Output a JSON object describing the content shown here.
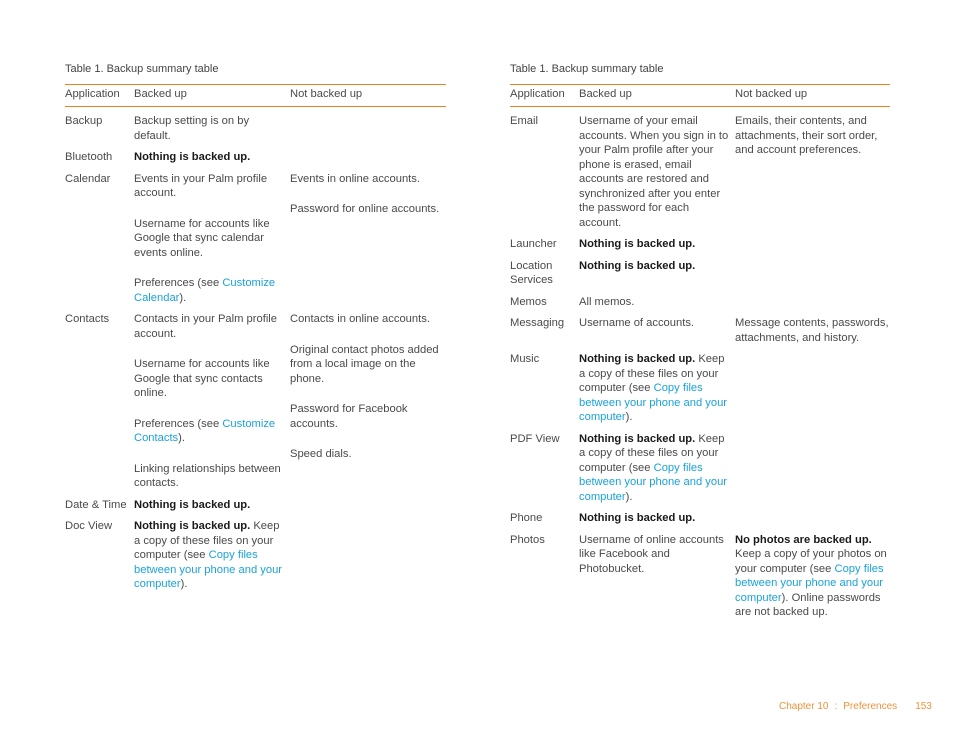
{
  "colors": {
    "rule": "#e8821e",
    "link": "#1aa3d9",
    "footer": "#f0923a"
  },
  "tables": [
    {
      "caption": "Table 1.  Backup summary table",
      "headers": {
        "app": "Application",
        "yes": "Backed up",
        "no": "Not backed up"
      },
      "rows": [
        {
          "app": "Backup",
          "yes": [
            [
              {
                "t": "Backup setting is on by default."
              }
            ]
          ],
          "no": []
        },
        {
          "app": "Bluetooth",
          "yes": [
            [
              {
                "t": "Nothing is backed up.",
                "b": true
              }
            ]
          ],
          "no": []
        },
        {
          "app": "Calendar",
          "yes": [
            [
              {
                "t": "Events in your Palm profile account."
              }
            ],
            [
              {
                "t": "Username for accounts like Google that sync calendar events online."
              }
            ],
            [
              {
                "t": "Preferences (see "
              },
              {
                "t": "Customize Calendar",
                "l": true
              },
              {
                "t": ")."
              }
            ]
          ],
          "no": [
            [
              {
                "t": "Events in online accounts."
              }
            ],
            [
              {
                "t": "Password for online accounts."
              }
            ]
          ]
        },
        {
          "app": "Contacts",
          "yes": [
            [
              {
                "t": "Contacts in your Palm profile account."
              }
            ],
            [
              {
                "t": "Username for accounts like Google that sync contacts online."
              }
            ],
            [
              {
                "t": "Preferences (see "
              },
              {
                "t": "Customize Contacts",
                "l": true
              },
              {
                "t": ")."
              }
            ],
            [
              {
                "t": "Linking relationships between contacts."
              }
            ]
          ],
          "no": [
            [
              {
                "t": "Contacts in online accounts."
              }
            ],
            [
              {
                "t": "Original contact photos added from a local image on the phone."
              }
            ],
            [
              {
                "t": "Password for Facebook accounts."
              }
            ],
            [
              {
                "t": "Speed dials."
              }
            ]
          ]
        },
        {
          "app": "Date & Time",
          "yes": [
            [
              {
                "t": "Nothing is backed up.",
                "b": true
              }
            ]
          ],
          "no": []
        },
        {
          "app": "Doc View",
          "yes": [
            [
              {
                "t": "Nothing is backed up.",
                "b": true
              },
              {
                "t": " Keep a copy of these files on your computer (see "
              },
              {
                "t": "Copy files between your phone and your computer",
                "l": true
              },
              {
                "t": ")."
              }
            ]
          ],
          "no": []
        }
      ]
    },
    {
      "caption": "Table 1.  Backup summary table",
      "headers": {
        "app": "Application",
        "yes": "Backed up",
        "no": "Not backed up"
      },
      "rows": [
        {
          "app": "Email",
          "yes": [
            [
              {
                "t": "Username of your email accounts. When you sign in to your Palm profile after your phone is erased, email accounts are restored and synchronized after you enter the password for each account."
              }
            ]
          ],
          "no": [
            [
              {
                "t": "Emails, their contents, and attachments, their sort order, and account preferences."
              }
            ]
          ]
        },
        {
          "app": "Launcher",
          "yes": [
            [
              {
                "t": "Nothing is backed up.",
                "b": true
              }
            ]
          ],
          "no": []
        },
        {
          "app": "Location Services",
          "yes": [
            [
              {
                "t": "Nothing is backed up.",
                "b": true
              }
            ]
          ],
          "no": []
        },
        {
          "app": "Memos",
          "yes": [
            [
              {
                "t": "All memos."
              }
            ]
          ],
          "no": []
        },
        {
          "app": "Messaging",
          "yes": [
            [
              {
                "t": "Username of accounts."
              }
            ]
          ],
          "no": [
            [
              {
                "t": "Message contents, passwords, attachments, and history."
              }
            ]
          ]
        },
        {
          "app": "Music",
          "yes": [
            [
              {
                "t": "Nothing is backed up.",
                "b": true
              },
              {
                "t": " Keep a copy of these files on your computer (see "
              },
              {
                "t": "Copy files between your phone and your computer",
                "l": true
              },
              {
                "t": ")."
              }
            ]
          ],
          "no": []
        },
        {
          "app": "PDF View",
          "yes": [
            [
              {
                "t": "Nothing is backed up.",
                "b": true
              },
              {
                "t": " Keep a copy of these files on your computer (see "
              },
              {
                "t": "Copy files between your phone and your computer",
                "l": true
              },
              {
                "t": ")."
              }
            ]
          ],
          "no": []
        },
        {
          "app": "Phone",
          "yes": [
            [
              {
                "t": "Nothing is backed up.",
                "b": true
              }
            ]
          ],
          "no": []
        },
        {
          "app": "Photos",
          "yes": [
            [
              {
                "t": "Username of online accounts like Facebook and Photobucket."
              }
            ]
          ],
          "no": [
            [
              {
                "t": "No photos are backed up.",
                "b": true
              },
              {
                "t": " Keep a copy of your photos on your computer (see "
              },
              {
                "t": "Copy files between your phone and your computer",
                "l": true
              },
              {
                "t": "). Online passwords are not backed up."
              }
            ]
          ]
        }
      ]
    }
  ],
  "footer": {
    "chapter": "Chapter 10",
    "separator": ":",
    "section": "Preferences",
    "page": "153"
  }
}
